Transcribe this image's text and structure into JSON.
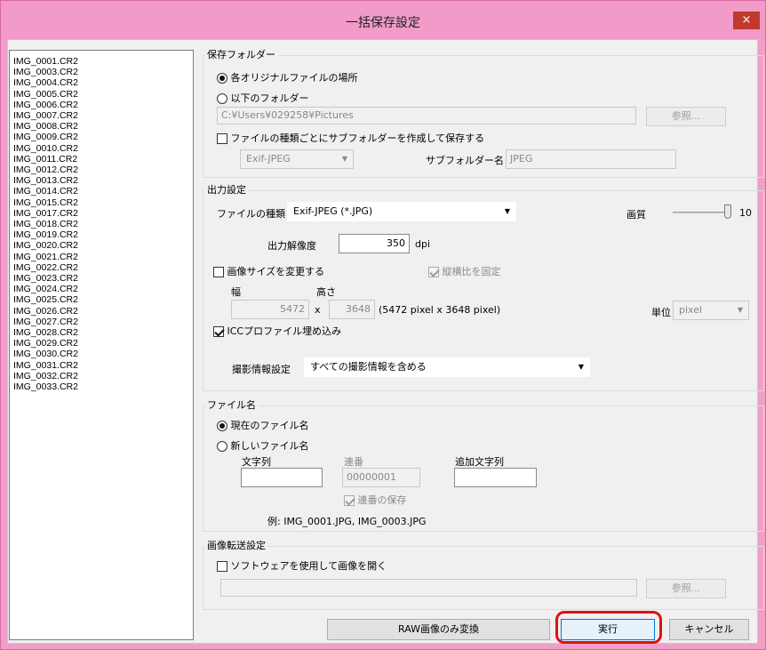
{
  "window": {
    "title": "一括保存設定",
    "close": "×"
  },
  "file_list": [
    "IMG_0001.CR2",
    "IMG_0003.CR2",
    "IMG_0004.CR2",
    "IMG_0005.CR2",
    "IMG_0006.CR2",
    "IMG_0007.CR2",
    "IMG_0008.CR2",
    "IMG_0009.CR2",
    "IMG_0010.CR2",
    "IMG_0011.CR2",
    "IMG_0012.CR2",
    "IMG_0013.CR2",
    "IMG_0014.CR2",
    "IMG_0015.CR2",
    "IMG_0017.CR2",
    "IMG_0018.CR2",
    "IMG_0019.CR2",
    "IMG_0020.CR2",
    "IMG_0021.CR2",
    "IMG_0022.CR2",
    "IMG_0023.CR2",
    "IMG_0024.CR2",
    "IMG_0025.CR2",
    "IMG_0026.CR2",
    "IMG_0027.CR2",
    "IMG_0028.CR2",
    "IMG_0029.CR2",
    "IMG_0030.CR2",
    "IMG_0031.CR2",
    "IMG_0032.CR2",
    "IMG_0033.CR2"
  ],
  "save_folder": {
    "title": "保存フォルダー",
    "radio_original": "各オリジナルファイルの場所",
    "radio_following": "以下のフォルダー",
    "path": "C:¥Users¥029258¥Pictures",
    "browse": "参照...",
    "subfolder_check": "ファイルの種類ごとにサブフォルダーを作成して保存する",
    "subfolder_type": "Exif-JPEG",
    "subfolder_name_label": "サブフォルダー名",
    "subfolder_name": "JPEG"
  },
  "output": {
    "title": "出力設定",
    "file_type_label": "ファイルの種類",
    "file_type": "Exif-JPEG (*.JPG)",
    "quality_label": "画質",
    "quality_value": "10",
    "quality_level": 1.0,
    "resolution_label": "出力解像度",
    "resolution": "350",
    "resolution_unit": "dpi",
    "resize_check": "画像サイズを変更する",
    "aspect_check": "縦横比を固定",
    "width_label": "幅",
    "height_label": "高さ",
    "width": "5472",
    "x_sep": "x",
    "height": "3648",
    "size_info": "(5472 pixel x 3648 pixel)",
    "unit_label": "単位",
    "unit": "pixel",
    "icc_check": "ICCプロファイル埋め込み",
    "shooting_label": "撮影情報設定",
    "shooting": "すべての撮影情報を含める"
  },
  "filename": {
    "title": "ファイル名",
    "radio_current": "現在のファイル名",
    "radio_new": "新しいファイル名",
    "string_label": "文字列",
    "serial_label": "連番",
    "serial": "00000001",
    "append_label": "追加文字列",
    "serial_save": "連番の保存",
    "example": "例:  IMG_0001.JPG, IMG_0003.JPG"
  },
  "transfer": {
    "title": "画像転送設定",
    "open_check": "ソフトウェアを使用して画像を開く",
    "browse": "参照..."
  },
  "buttons": {
    "raw_only": "RAW画像のみ変換",
    "execute": "実行",
    "cancel": "キャンセル"
  },
  "colors": {
    "titlebar": "#f29ac8",
    "close": "#c0392b",
    "highlight": "#e01010"
  }
}
